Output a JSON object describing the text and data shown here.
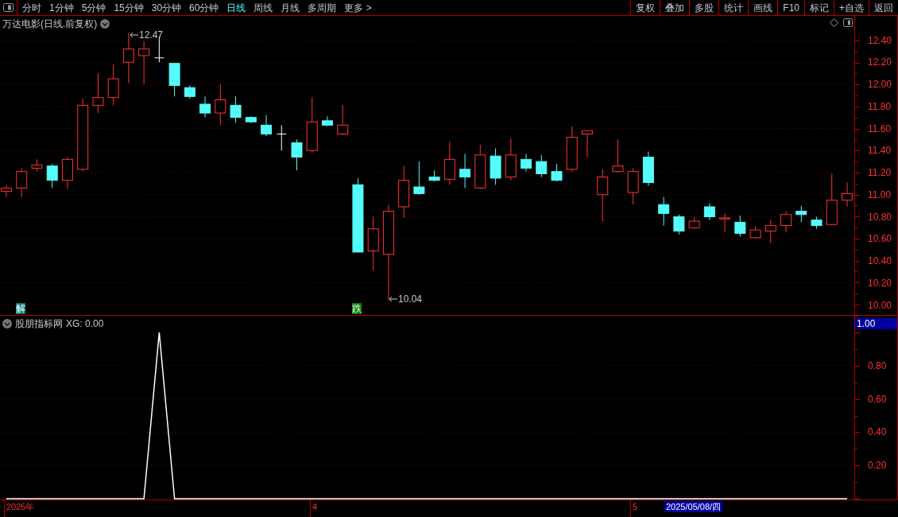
{
  "toolbar": {
    "tabs": [
      {
        "label": "分时",
        "selected": false
      },
      {
        "label": "1分钟",
        "selected": false
      },
      {
        "label": "5分钟",
        "selected": false
      },
      {
        "label": "15分钟",
        "selected": false
      },
      {
        "label": "30分钟",
        "selected": false
      },
      {
        "label": "60分钟",
        "selected": false
      },
      {
        "label": "日线",
        "selected": true
      },
      {
        "label": "周线",
        "selected": false
      },
      {
        "label": "月线",
        "selected": false
      },
      {
        "label": "多周期",
        "selected": false
      },
      {
        "label": "更多 >",
        "selected": false
      }
    ],
    "buttons": [
      "复权",
      "叠加",
      "多股",
      "统计",
      "画线",
      "F10",
      "标记",
      "+自选",
      "返回"
    ]
  },
  "price_chart": {
    "title": "万达电影(日线.前复权)",
    "annotations": [
      {
        "kind": "high",
        "text": "12.47"
      },
      {
        "kind": "low",
        "text": "10.04"
      }
    ],
    "signals": [
      {
        "text": "解",
        "color": "#007b7b"
      },
      {
        "text": "跌",
        "color": "#008000"
      }
    ],
    "chart_data": {
      "type": "candlestick",
      "grid": true,
      "ylim": [
        9.91,
        12.62
      ],
      "yticks": [
        {
          "value": 12.4,
          "label": "12.40"
        },
        {
          "value": 12.2,
          "label": "12.20"
        },
        {
          "value": 12.0,
          "label": "12.00"
        },
        {
          "value": 11.8,
          "label": "11.80"
        },
        {
          "value": 11.6,
          "label": "11.60"
        },
        {
          "value": 11.4,
          "label": "11.40"
        },
        {
          "value": 11.2,
          "label": "11.20"
        },
        {
          "value": 11.0,
          "label": "11.00"
        },
        {
          "value": 10.8,
          "label": "10.80"
        },
        {
          "value": 10.6,
          "label": "10.60"
        },
        {
          "value": 10.4,
          "label": "10.40"
        },
        {
          "value": 10.2,
          "label": "10.20"
        },
        {
          "value": 10.0,
          "label": "10.00"
        }
      ],
      "categories": [
        null,
        null,
        null,
        null,
        null,
        null,
        null,
        null,
        null,
        null,
        null,
        null,
        null,
        null,
        null,
        null,
        null,
        null,
        null,
        null,
        null,
        null,
        null,
        null,
        null,
        null,
        null,
        null,
        null,
        null,
        null,
        null,
        null,
        null,
        null,
        null,
        null,
        null,
        null,
        null,
        null,
        null,
        null,
        null,
        null,
        null,
        null,
        null,
        null,
        null,
        null,
        null,
        null,
        null,
        null,
        null
      ],
      "ohlc": [
        [
          11.03,
          11.09,
          10.98,
          11.06
        ],
        [
          11.06,
          11.24,
          10.98,
          11.21
        ],
        [
          11.24,
          11.32,
          11.21,
          11.27
        ],
        [
          11.26,
          11.28,
          11.06,
          11.13
        ],
        [
          11.13,
          11.34,
          11.05,
          11.32
        ],
        [
          11.23,
          11.87,
          11.21,
          11.81
        ],
        [
          11.81,
          12.1,
          11.74,
          11.88
        ],
        [
          11.88,
          12.18,
          11.81,
          12.05
        ],
        [
          12.2,
          12.47,
          12.01,
          12.32
        ],
        [
          12.26,
          12.39,
          12.0,
          12.32
        ],
        [
          12.24,
          12.43,
          12.2,
          12.24
        ],
        [
          12.19,
          12.19,
          11.89,
          11.99
        ],
        [
          11.97,
          11.99,
          11.87,
          11.89
        ],
        [
          11.82,
          11.89,
          11.7,
          11.74
        ],
        [
          11.74,
          12.0,
          11.63,
          11.86
        ],
        [
          11.81,
          11.89,
          11.65,
          11.7
        ],
        [
          11.7,
          11.71,
          11.65,
          11.66
        ],
        [
          11.63,
          11.72,
          11.53,
          11.55
        ],
        [
          11.55,
          11.63,
          11.4,
          11.55
        ],
        [
          11.47,
          11.5,
          11.22,
          11.34
        ],
        [
          11.4,
          11.88,
          11.38,
          11.66
        ],
        [
          11.67,
          11.71,
          11.62,
          11.63
        ],
        [
          11.55,
          11.81,
          11.54,
          11.63
        ],
        [
          11.09,
          11.15,
          10.48,
          10.48
        ],
        [
          10.49,
          10.8,
          10.31,
          10.69
        ],
        [
          10.46,
          10.91,
          10.04,
          10.85
        ],
        [
          10.89,
          11.26,
          10.79,
          11.13
        ],
        [
          11.07,
          11.3,
          11.0,
          11.01
        ],
        [
          11.16,
          11.22,
          11.12,
          11.13
        ],
        [
          11.14,
          11.48,
          11.09,
          11.32
        ],
        [
          11.23,
          11.37,
          11.06,
          11.16
        ],
        [
          11.06,
          11.45,
          11.05,
          11.36
        ],
        [
          11.35,
          11.42,
          11.09,
          11.15
        ],
        [
          11.16,
          11.51,
          11.13,
          11.36
        ],
        [
          11.32,
          11.37,
          11.21,
          11.24
        ],
        [
          11.3,
          11.36,
          11.16,
          11.19
        ],
        [
          11.21,
          11.28,
          11.12,
          11.13
        ],
        [
          11.23,
          11.62,
          11.21,
          11.52
        ],
        [
          11.55,
          11.58,
          11.34,
          11.58
        ],
        [
          11.0,
          11.23,
          10.76,
          11.16
        ],
        [
          11.21,
          11.5,
          11.2,
          11.26
        ],
        [
          11.02,
          11.24,
          10.91,
          11.21
        ],
        [
          11.34,
          11.39,
          11.08,
          11.11
        ],
        [
          10.91,
          10.98,
          10.72,
          10.83
        ],
        [
          10.8,
          10.82,
          10.64,
          10.67
        ],
        [
          10.7,
          10.8,
          10.69,
          10.76
        ],
        [
          10.89,
          10.92,
          10.77,
          10.8
        ],
        [
          10.78,
          10.83,
          10.66,
          10.79
        ],
        [
          10.75,
          10.81,
          10.62,
          10.65
        ],
        [
          10.61,
          10.71,
          10.6,
          10.68
        ],
        [
          10.67,
          10.77,
          10.56,
          10.72
        ],
        [
          10.72,
          10.85,
          10.66,
          10.82
        ],
        [
          10.85,
          10.9,
          10.75,
          10.82
        ],
        [
          10.77,
          10.8,
          10.69,
          10.72
        ],
        [
          10.73,
          11.19,
          10.72,
          10.95
        ],
        [
          10.95,
          11.11,
          10.89,
          11.01
        ]
      ]
    }
  },
  "indicator": {
    "title": "股朋指标网",
    "reading": ": 0.00",
    "cursor_value": "1.00",
    "chart_data": {
      "type": "line",
      "grid": true,
      "series": [
        {
          "name": "XG",
          "color": "#ffffff",
          "values": [
            0,
            0,
            0,
            0,
            0,
            0,
            0,
            0,
            0,
            0,
            1,
            0,
            0,
            0,
            0,
            0,
            0,
            0,
            0,
            0,
            0,
            0,
            0,
            0,
            0,
            0,
            0,
            0,
            0,
            0,
            0,
            0,
            0,
            0,
            0,
            0,
            0,
            0,
            0,
            0,
            0,
            0,
            0,
            0,
            0,
            0,
            0,
            0,
            0,
            0,
            0,
            0,
            0,
            0,
            0,
            0
          ]
        }
      ],
      "categories": [
        null,
        null,
        null,
        null,
        null,
        null,
        null,
        null,
        null,
        null,
        null,
        null,
        null,
        null,
        null,
        null,
        null,
        null,
        null,
        null,
        null,
        null,
        null,
        null,
        null,
        null,
        null,
        null,
        null,
        null,
        null,
        null,
        null,
        null,
        null,
        null,
        null,
        null,
        null,
        null,
        null,
        null,
        null,
        null,
        null,
        null,
        null,
        null,
        null,
        null,
        null,
        null,
        null,
        null,
        null,
        null
      ],
      "ylim": [
        0,
        1.1
      ],
      "yticks": [
        {
          "value": 0.2,
          "label": "0.20"
        },
        {
          "value": 0.4,
          "label": "0.40"
        },
        {
          "value": 0.6,
          "label": "0.60"
        },
        {
          "value": 0.8,
          "label": "0.80"
        }
      ]
    }
  },
  "time_axis": {
    "labels": [
      "2025年",
      "4",
      "5"
    ],
    "cursor_date": "2025/05/08/四"
  }
}
